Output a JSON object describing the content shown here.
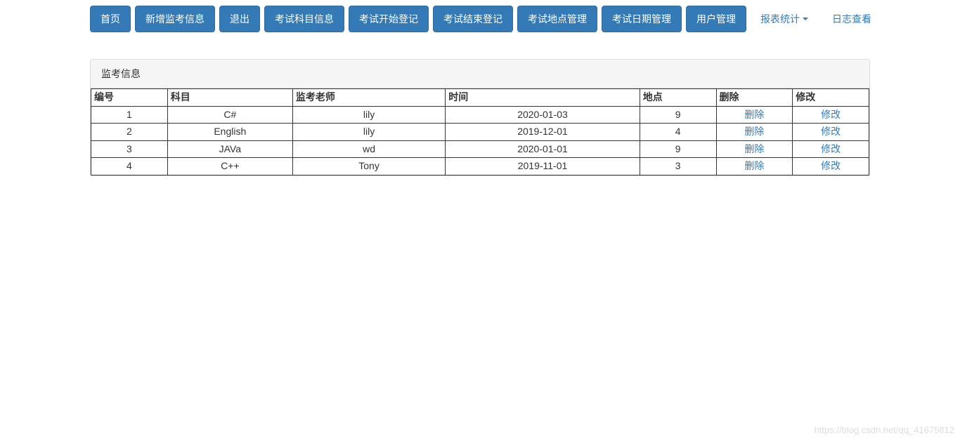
{
  "nav": {
    "buttons": [
      {
        "label": "首页",
        "name": "nav-home"
      },
      {
        "label": "新增监考信息",
        "name": "nav-add-invigilation"
      },
      {
        "label": "退出",
        "name": "nav-logout"
      },
      {
        "label": "考试科目信息",
        "name": "nav-subject-info"
      },
      {
        "label": "考试开始登记",
        "name": "nav-start-register"
      },
      {
        "label": "考试结束登记",
        "name": "nav-end-register"
      },
      {
        "label": "考试地点管理",
        "name": "nav-location-manage"
      },
      {
        "label": "考试日期管理",
        "name": "nav-date-manage"
      },
      {
        "label": "用户管理",
        "name": "nav-user-manage"
      }
    ],
    "links": [
      {
        "label": "报表统计",
        "name": "nav-report-stats",
        "dropdown": true
      },
      {
        "label": "日志查看",
        "name": "nav-log-view",
        "dropdown": false
      }
    ]
  },
  "panel": {
    "title": "监考信息"
  },
  "table": {
    "headers": {
      "id": "编号",
      "subject": "科目",
      "teacher": "监考老师",
      "time": "时间",
      "location": "地点",
      "delete": "删除",
      "modify": "修改"
    },
    "delete_label": "删除",
    "modify_label": "修改",
    "rows": [
      {
        "id": "1",
        "subject": "C#",
        "teacher": "lily",
        "time": "2020-01-03",
        "location": "9"
      },
      {
        "id": "2",
        "subject": "English",
        "teacher": "lily",
        "time": "2019-12-01",
        "location": "4"
      },
      {
        "id": "3",
        "subject": "JAVa",
        "teacher": "wd",
        "time": "2020-01-01",
        "location": "9"
      },
      {
        "id": "4",
        "subject": "C++",
        "teacher": "Tony",
        "time": "2019-11-01",
        "location": "3"
      }
    ]
  },
  "watermark": "https://blog.csdn.net/qq_41675812"
}
